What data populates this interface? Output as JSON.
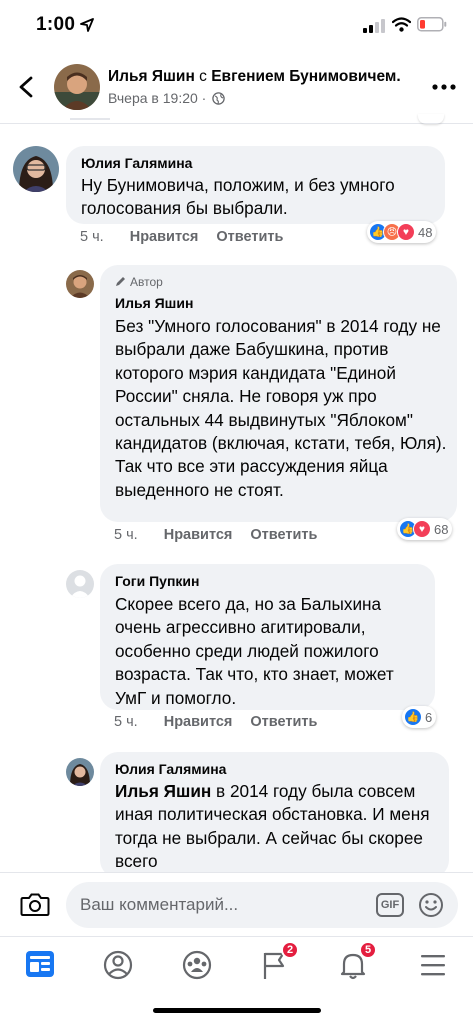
{
  "status_bar": {
    "time": "1:00"
  },
  "header": {
    "author": "Илья Яшин",
    "connector": "с",
    "tagged": "Евгением Бунимовичем.",
    "time": "Вчера в 19:20 ·"
  },
  "comments": [
    {
      "name": "Юлия Галямина",
      "text": "Ну Бунимовича, положим,  и без умного голосования бы выбрали.",
      "time": "5 ч.",
      "like_label": "Нравится",
      "reply_label": "Ответить",
      "reactions_count": "48"
    },
    {
      "badge": "Автор",
      "name": "Илья Яшин",
      "text": "Без \"Умного голосования\" в 2014 году не выбрали даже Бабушкина, против которого мэрия кандидата \"Единой России\" сняла. Не говоря уж про остальных 44 выдвинутых \"Яблоком\" кандидатов (включая, кстати, тебя, Юля). Так что все эти рассуждения яйца выеденного не стоят.",
      "time": "5 ч.",
      "like_label": "Нравится",
      "reply_label": "Ответить",
      "reactions_count": "68"
    },
    {
      "name": "Гоги Пупкин",
      "text": "Скорее всего да, но за Балыхина очень агрессивно агитировали, особенно среди людей пожилого возраста. Так что, кто знает, может УмГ и помогло.",
      "time": "5 ч.",
      "like_label": "Нравится",
      "reply_label": "Ответить",
      "reactions_count": "6"
    },
    {
      "name": "Юлия Галямина",
      "mention": "Илья Яшин",
      "text": " в 2014 году была совсем иная политическая обстановка. И меня тогда не выбрали. А сейчас бы скорее всего"
    }
  ],
  "composer": {
    "placeholder": "Ваш комментарий...",
    "gif_label": "GIF"
  },
  "tabbar": {
    "tabs": [
      "news-feed-icon",
      "profile-icon",
      "groups-icon",
      "pages-flag-icon",
      "notifications-bell-icon",
      "menu-icon"
    ],
    "pages_badge": "2",
    "notifications_badge": "5"
  },
  "colors": {
    "accent": "#1877f2",
    "badge": "#e41e3f",
    "bubble": "#f0f2f5",
    "meta": "#65676b"
  }
}
